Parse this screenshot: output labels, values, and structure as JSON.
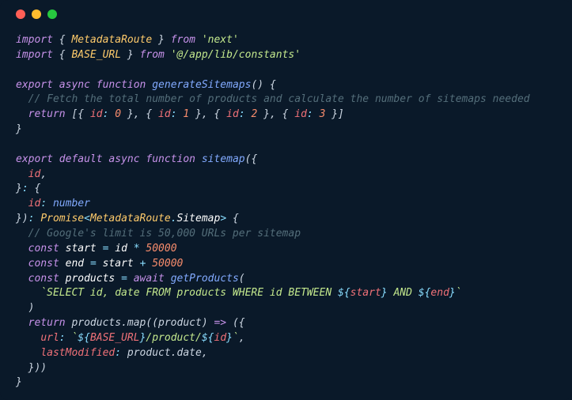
{
  "code": {
    "line1_import": "import",
    "line1_brace_open": " { ",
    "line1_MetadataRoute": "MetadataRoute",
    "line1_brace_close": " } ",
    "line1_from": "from",
    "line1_sp": " ",
    "line1_module": "'next'",
    "line2_import": "import",
    "line2_brace_open": " { ",
    "line2_BASE_URL": "BASE_URL",
    "line2_brace_close": " } ",
    "line2_from": "from",
    "line2_sp": " ",
    "line2_module": "'@/app/lib/constants'",
    "blank3": "",
    "line4_export": "export",
    "line4_sp1": " ",
    "line4_async": "async",
    "line4_sp2": " ",
    "line4_function": "function",
    "line4_sp3": " ",
    "line4_name": "generateSitemaps",
    "line4_parens": "()",
    "line4_sp4": " ",
    "line4_brace": "{",
    "line5_ind": "  ",
    "line5_comment": "// Fetch the total number of products and calculate the number of sitemaps needed",
    "line6_ind": "  ",
    "line6_return": "return",
    "line6_sp": " ",
    "line6_open": "[{ ",
    "line6_id0k": "id",
    "line6_colon0": ": ",
    "line6_id0v": "0",
    "line6_sep1": " }, { ",
    "line6_id1k": "id",
    "line6_colon1": ": ",
    "line6_id1v": "1",
    "line6_sep2": " }, { ",
    "line6_id2k": "id",
    "line6_colon2": ": ",
    "line6_id2v": "2",
    "line6_sep3": " }, { ",
    "line6_id3k": "id",
    "line6_colon3": ": ",
    "line6_id3v": "3",
    "line6_close": " }]",
    "line7_brace": "}",
    "blank8": "",
    "line9_export": "export",
    "line9_sp1": " ",
    "line9_default": "default",
    "line9_sp2": " ",
    "line9_async": "async",
    "line9_sp3": " ",
    "line9_function": "function",
    "line9_sp4": " ",
    "line9_name": "sitemap",
    "line9_paren_open": "(",
    "line9_brace": "{",
    "line10_ind": "  ",
    "line10_id": "id",
    "line10_comma": ",",
    "line11_close": "}",
    "line11_colon": ": ",
    "line11_brace": "{",
    "line12_ind": "  ",
    "line12_id": "id",
    "line12_colon": ": ",
    "line12_number": "number",
    "line13_close": "}",
    "line13_paren": ")",
    "line13_colon": ": ",
    "line13_Promise": "Promise",
    "line13_lt": "<",
    "line13_MetadataRoute": "MetadataRoute",
    "line13_dot": ".",
    "line13_Sitemap": "Sitemap",
    "line13_gt": ">",
    "line13_sp": " ",
    "line13_brace": "{",
    "line14_ind": "  ",
    "line14_comment": "// Google's limit is 50,000 URLs per sitemap",
    "line15_ind": "  ",
    "line15_const": "const",
    "line15_sp1": " ",
    "line15_start": "start",
    "line15_sp2": " ",
    "line15_eq": "=",
    "line15_sp3": " ",
    "line15_id": "id",
    "line15_sp4": " ",
    "line15_mul": "*",
    "line15_sp5": " ",
    "line15_50000": "50000",
    "line16_ind": "  ",
    "line16_const": "const",
    "line16_sp1": " ",
    "line16_end": "end",
    "line16_sp2": " ",
    "line16_eq": "=",
    "line16_sp3": " ",
    "line16_start": "start",
    "line16_sp4": " ",
    "line16_plus": "+",
    "line16_sp5": " ",
    "line16_50000": "50000",
    "line17_ind": "  ",
    "line17_const": "const",
    "line17_sp1": " ",
    "line17_products": "products",
    "line17_sp2": " ",
    "line17_eq": "=",
    "line17_sp3": " ",
    "line17_await": "await",
    "line17_sp4": " ",
    "line17_getProducts": "getProducts",
    "line17_paren": "(",
    "line18_ind": "    ",
    "line18_tick1": "`",
    "line18_sql1": "SELECT id, date FROM products WHERE id BETWEEN ",
    "line18_dollar1": "${",
    "line18_start": "start",
    "line18_close1": "}",
    "line18_sql2": " AND ",
    "line18_dollar2": "${",
    "line18_end": "end",
    "line18_close2": "}",
    "line18_tick2": "`",
    "line19_ind": "  ",
    "line19_paren": ")",
    "line20_ind": "  ",
    "line20_return": "return",
    "line20_sp": " ",
    "line20_productsmap": "products.map((product) ",
    "line20_arrow": "=>",
    "line20_sp2": " ",
    "line20_open": "({",
    "line21_ind": "    ",
    "line21_url": "url",
    "line21_colon": ": ",
    "line21_tick1": "`",
    "line21_dollar1": "${",
    "line21_BASE_URL": "BASE_URL",
    "line21_close1": "}",
    "line21_product": "/product/",
    "line21_dollar2": "${",
    "line21_id": "id",
    "line21_close2": "}",
    "line21_tick2": "`",
    "line21_comma": ",",
    "line22_ind": "    ",
    "line22_lastModified": "lastModified",
    "line22_colon": ": ",
    "line22_productdate": "product.date",
    "line22_comma": ",",
    "line23_ind": "  ",
    "line23_close": "}))",
    "line24_brace": "}"
  }
}
